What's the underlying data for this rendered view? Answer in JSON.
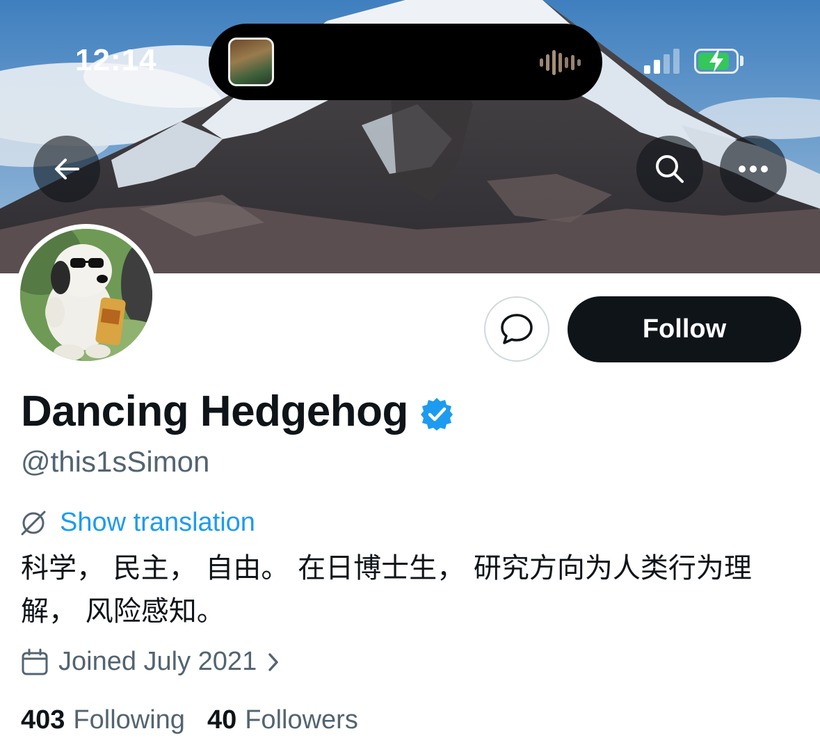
{
  "status_bar": {
    "time": "12:14"
  },
  "profile": {
    "display_name": "Dancing Hedgehog",
    "handle": "@this1sSimon",
    "verified": true,
    "show_translation_label": "Show translation",
    "bio_line1": "科学， 民主， 自由。 在日博士生， 研究方向为人类行为理",
    "bio_line2": "解， 风险感知。",
    "joined": "Joined July 2021",
    "following_count": "403",
    "following_label": "Following",
    "followers_count": "40",
    "followers_label": "Followers"
  },
  "actions": {
    "follow_label": "Follow"
  },
  "icons": {
    "back": "arrow-left-icon",
    "search": "search-icon",
    "more": "more-horizontal-icon",
    "message": "message-bubble-icon",
    "verified": "verified-badge-icon",
    "translate": "globe-translate-icon",
    "calendar": "calendar-icon",
    "chevron": "chevron-right-icon"
  },
  "colors": {
    "accent": "#1d9bf0",
    "text_primary": "#0f1419",
    "text_secondary": "#536471",
    "follow_button_bg": "#0f1419",
    "battery_green": "#34c759"
  }
}
